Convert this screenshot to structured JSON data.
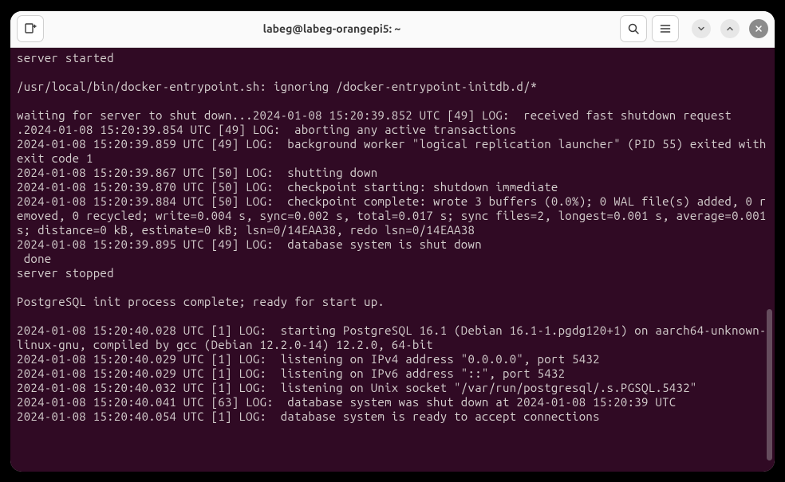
{
  "window": {
    "title": "labeg@labeg-orangepi5: ~"
  },
  "terminal": {
    "lines": [
      "server started",
      "",
      "/usr/local/bin/docker-entrypoint.sh: ignoring /docker-entrypoint-initdb.d/*",
      "",
      "waiting for server to shut down...2024-01-08 15:20:39.852 UTC [49] LOG:  received fast shutdown request",
      ".2024-01-08 15:20:39.854 UTC [49] LOG:  aborting any active transactions",
      "2024-01-08 15:20:39.859 UTC [49] LOG:  background worker \"logical replication launcher\" (PID 55) exited with exit code 1",
      "2024-01-08 15:20:39.867 UTC [50] LOG:  shutting down",
      "2024-01-08 15:20:39.870 UTC [50] LOG:  checkpoint starting: shutdown immediate",
      "2024-01-08 15:20:39.884 UTC [50] LOG:  checkpoint complete: wrote 3 buffers (0.0%); 0 WAL file(s) added, 0 removed, 0 recycled; write=0.004 s, sync=0.002 s, total=0.017 s; sync files=2, longest=0.001 s, average=0.001 s; distance=0 kB, estimate=0 kB; lsn=0/14EAA38, redo lsn=0/14EAA38",
      "2024-01-08 15:20:39.895 UTC [49] LOG:  database system is shut down",
      " done",
      "server stopped",
      "",
      "PostgreSQL init process complete; ready for start up.",
      "",
      "2024-01-08 15:20:40.028 UTC [1] LOG:  starting PostgreSQL 16.1 (Debian 16.1-1.pgdg120+1) on aarch64-unknown-linux-gnu, compiled by gcc (Debian 12.2.0-14) 12.2.0, 64-bit",
      "2024-01-08 15:20:40.029 UTC [1] LOG:  listening on IPv4 address \"0.0.0.0\", port 5432",
      "2024-01-08 15:20:40.029 UTC [1] LOG:  listening on IPv6 address \"::\", port 5432",
      "2024-01-08 15:20:40.032 UTC [1] LOG:  listening on Unix socket \"/var/run/postgresql/.s.PGSQL.5432\"",
      "2024-01-08 15:20:40.041 UTC [63] LOG:  database system was shut down at 2024-01-08 15:20:39 UTC",
      "2024-01-08 15:20:40.054 UTC [1] LOG:  database system is ready to accept connections"
    ]
  }
}
